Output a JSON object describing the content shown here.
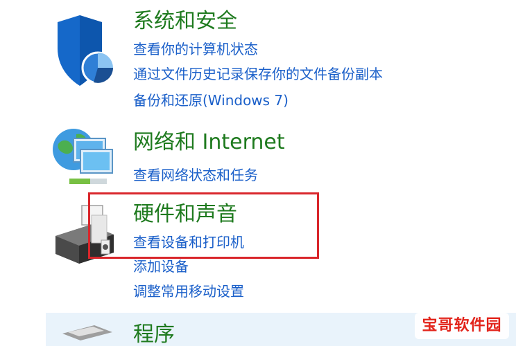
{
  "categories": {
    "system_security": {
      "title": "系统和安全",
      "icon": "shield-icon",
      "links": [
        "查看你的计算机状态",
        "通过文件历史记录保存你的文件备份副本",
        "备份和还原(Windows 7)"
      ]
    },
    "network": {
      "title": "网络和 Internet",
      "icon": "network-globe-icon",
      "links": [
        "查看网络状态和任务"
      ]
    },
    "hardware": {
      "title": "硬件和声音",
      "icon": "printer-icon",
      "links": [
        "查看设备和打印机",
        "添加设备",
        "调整常用移动设置"
      ]
    },
    "programs": {
      "title": "程序",
      "icon": "programs-icon"
    }
  },
  "watermark": {
    "text": "宝哥软件园"
  },
  "colors": {
    "title_green": "#1e7a1e",
    "link_blue": "#1a5fc9",
    "highlight_red": "#d9262b",
    "hover_bg": "#e9f3fb",
    "watermark_red": "#e2231a"
  }
}
